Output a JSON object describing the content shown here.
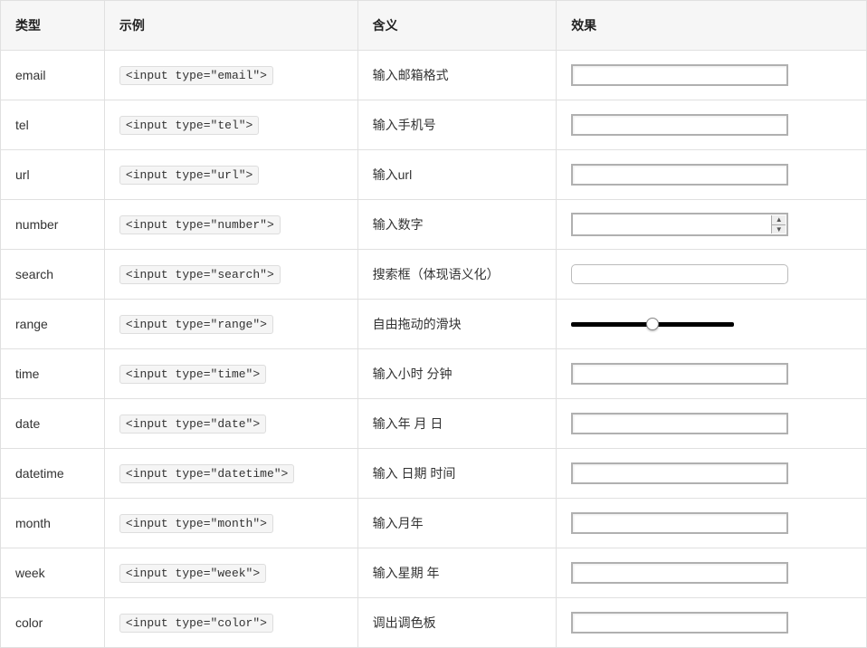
{
  "headers": {
    "type": "类型",
    "example": "示例",
    "meaning": "含义",
    "effect": "效果"
  },
  "rows": [
    {
      "type": "email",
      "example": "<input type=\"email\">",
      "meaning": "输入邮箱格式",
      "fx": "box"
    },
    {
      "type": "tel",
      "example": "<input type=\"tel\">",
      "meaning": "输入手机号",
      "fx": "box"
    },
    {
      "type": "url",
      "example": "<input type=\"url\">",
      "meaning": "输入url",
      "fx": "box"
    },
    {
      "type": "number",
      "example": "<input type=\"number\">",
      "meaning": "输入数字",
      "fx": "number"
    },
    {
      "type": "search",
      "example": "<input type=\"search\">",
      "meaning": "搜索框（体现语义化）",
      "fx": "search"
    },
    {
      "type": "range",
      "example": "<input type=\"range\">",
      "meaning": "自由拖动的滑块",
      "fx": "range"
    },
    {
      "type": "time",
      "example": "<input type=\"time\">",
      "meaning": "输入小时 分钟",
      "fx": "box"
    },
    {
      "type": "date",
      "example": "<input type=\"date\">",
      "meaning": "输入年 月 日",
      "fx": "box"
    },
    {
      "type": "datetime",
      "example": "<input type=\"datetime\">",
      "meaning": "输入 日期 时间",
      "fx": "box"
    },
    {
      "type": "month",
      "example": "<input type=\"month\">",
      "meaning": "输入月年",
      "fx": "box"
    },
    {
      "type": "week",
      "example": "<input type=\"week\">",
      "meaning": "输入星期 年",
      "fx": "box"
    },
    {
      "type": "color",
      "example": "<input type=\"color\">",
      "meaning": "调出调色板",
      "fx": "box"
    }
  ]
}
